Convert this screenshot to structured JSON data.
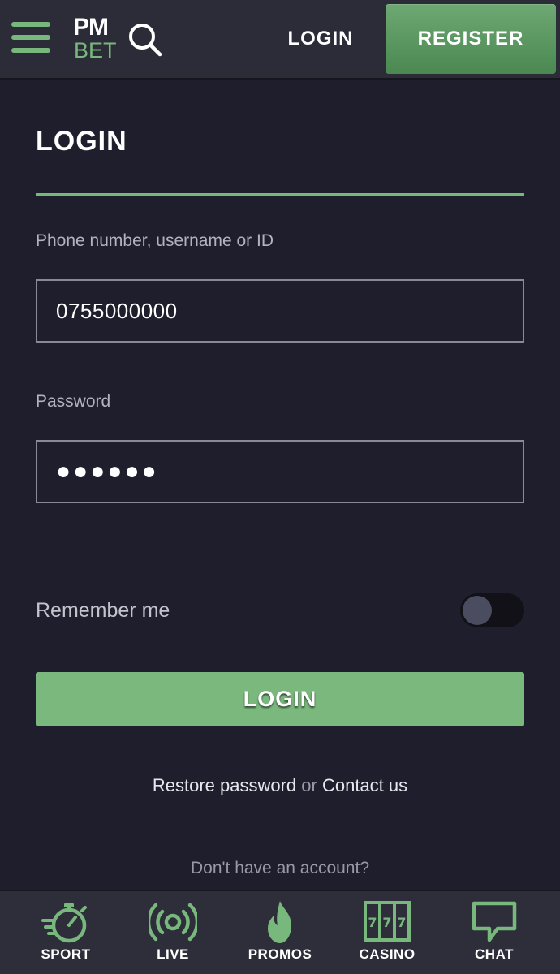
{
  "header": {
    "logo_top": "PM",
    "logo_bottom": "BET",
    "login_label": "LOGIN",
    "register_label": "REGISTER"
  },
  "form": {
    "title": "LOGIN",
    "username_label": "Phone number, username or ID",
    "username_value": "0755000000",
    "password_label": "Password",
    "password_value": "●●●●●●",
    "remember_label": "Remember me",
    "remember_checked": false,
    "submit_label": "LOGIN",
    "restore_link": "Restore password",
    "or_text": " or ",
    "contact_link": "Contact us",
    "no_account_text": "Don't have an account?"
  },
  "bottom_nav": {
    "items": [
      {
        "label": "SPORT",
        "icon": "stopwatch-icon"
      },
      {
        "label": "LIVE",
        "icon": "broadcast-icon"
      },
      {
        "label": "PROMOS",
        "icon": "flame-icon"
      },
      {
        "label": "CASINO",
        "icon": "slot-machine-icon"
      },
      {
        "label": "CHAT",
        "icon": "chat-bubble-icon"
      }
    ]
  },
  "colors": {
    "accent_green": "#79b87d",
    "background": "#1f1e2d",
    "header_bg": "#2c2b38"
  }
}
